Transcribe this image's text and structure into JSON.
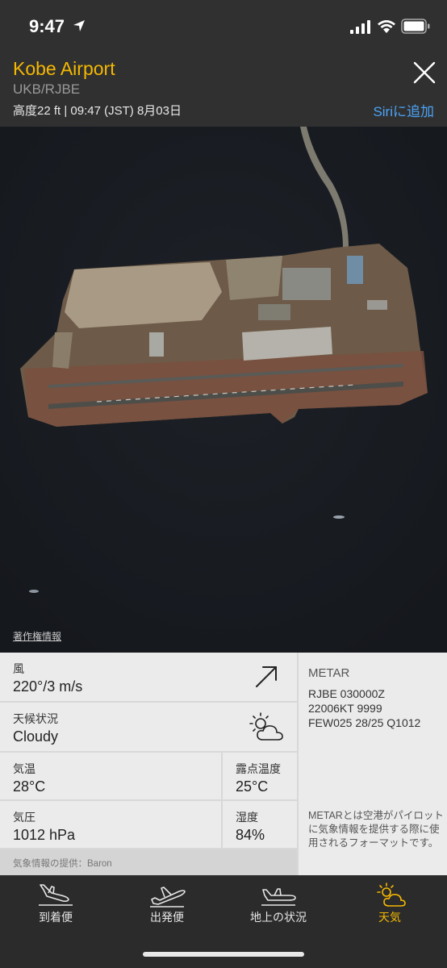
{
  "status_bar": {
    "time": "9:47"
  },
  "header": {
    "title": "Kobe Airport",
    "code": "UKB/RJBE",
    "meta": "高度22 ft | 09:47 (JST) 8月03日",
    "siri_label": "Siriに追加"
  },
  "map": {
    "copyright": "著作権情報"
  },
  "weather": {
    "wind": {
      "label": "風",
      "value": "220°/3 m/s"
    },
    "condition": {
      "label": "天候状況",
      "value": "Cloudy"
    },
    "temperature": {
      "label": "気温",
      "value": "28°C"
    },
    "dew_point": {
      "label": "露点温度",
      "value": "25°C"
    },
    "pressure": {
      "label": "気圧",
      "value": "1012 hPa"
    },
    "humidity": {
      "label": "湿度",
      "value": "84%"
    },
    "provider": "気象情報の提供：Baron"
  },
  "metar": {
    "heading": "METAR",
    "lines": [
      "RJBE 030000Z",
      "22006KT 9999",
      "FEW025 28/25 Q1012"
    ],
    "description": "METARとは空港がパイロットに気象情報を提供する際に使用されるフォーマットです。"
  },
  "tabs": [
    {
      "label": "到着便",
      "icon": "arrival-plane-icon",
      "active": false
    },
    {
      "label": "出発便",
      "icon": "departure-plane-icon",
      "active": false
    },
    {
      "label": "地上の状況",
      "icon": "ground-plane-icon",
      "active": false
    },
    {
      "label": "天気",
      "icon": "weather-icon",
      "active": true
    }
  ],
  "colors": {
    "accent": "#f5b800",
    "link": "#4ba3f5",
    "header_bg": "#303030"
  }
}
